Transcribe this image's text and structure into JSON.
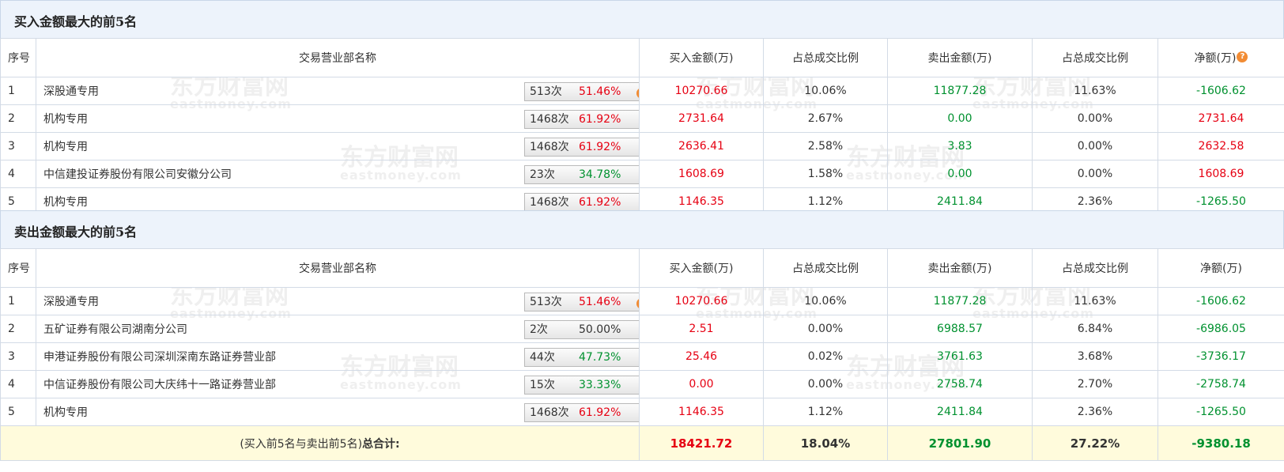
{
  "buy_section": {
    "title": "买入金额最大的前5名",
    "headers": [
      "序号",
      "交易营业部名称",
      "买入金额(万)",
      "占总成交比例",
      "卖出金额(万)",
      "占总成交比例",
      "净额(万)"
    ],
    "rows": [
      {
        "rank": "1",
        "name": "深股通专用",
        "count": "513次",
        "pct": "51.46%",
        "pct_color": "red",
        "icon": "question-icon",
        "buy": "10270.66",
        "buy_ratio": "10.06%",
        "sell": "11877.28",
        "sell_ratio": "11.63%",
        "net": "-1606.62",
        "net_color": "green"
      },
      {
        "rank": "2",
        "name": "机构专用",
        "count": "1468次",
        "pct": "61.92%",
        "pct_color": "red",
        "icon": "arrow-right-icon",
        "buy": "2731.64",
        "buy_ratio": "2.67%",
        "sell": "0.00",
        "sell_ratio": "0.00%",
        "net": "2731.64",
        "net_color": "red"
      },
      {
        "rank": "3",
        "name": "机构专用",
        "count": "1468次",
        "pct": "61.92%",
        "pct_color": "red",
        "icon": "arrow-right-icon",
        "buy": "2636.41",
        "buy_ratio": "2.58%",
        "sell": "3.83",
        "sell_ratio": "0.00%",
        "net": "2632.58",
        "net_color": "red"
      },
      {
        "rank": "4",
        "name": "中信建投证券股份有限公司安徽分公司",
        "count": "23次",
        "pct": "34.78%",
        "pct_color": "green",
        "icon": "arrow-right-icon",
        "buy": "1608.69",
        "buy_ratio": "1.58%",
        "sell": "0.00",
        "sell_ratio": "0.00%",
        "net": "1608.69",
        "net_color": "red"
      },
      {
        "rank": "5",
        "name": "机构专用",
        "count": "1468次",
        "pct": "61.92%",
        "pct_color": "red",
        "icon": "arrow-right-icon",
        "buy": "1146.35",
        "buy_ratio": "1.12%",
        "sell": "2411.84",
        "sell_ratio": "2.36%",
        "net": "-1265.50",
        "net_color": "green"
      }
    ]
  },
  "sell_section": {
    "title": "卖出金额最大的前5名",
    "headers": [
      "序号",
      "交易营业部名称",
      "买入金额(万)",
      "占总成交比例",
      "卖出金额(万)",
      "占总成交比例",
      "净额(万)"
    ],
    "rows": [
      {
        "rank": "1",
        "name": "深股通专用",
        "count": "513次",
        "pct": "51.46%",
        "pct_color": "red",
        "icon": "question-icon",
        "buy": "10270.66",
        "buy_ratio": "10.06%",
        "sell": "11877.28",
        "sell_ratio": "11.63%",
        "net": "-1606.62",
        "net_color": "green"
      },
      {
        "rank": "2",
        "name": "五矿证券有限公司湖南分公司",
        "count": "2次",
        "pct": "50.00%",
        "pct_color": "dark",
        "icon": "arrow-right-icon",
        "buy": "2.51",
        "buy_ratio": "0.00%",
        "sell": "6988.57",
        "sell_ratio": "6.84%",
        "net": "-6986.05",
        "net_color": "green"
      },
      {
        "rank": "3",
        "name": "申港证券股份有限公司深圳深南东路证券营业部",
        "count": "44次",
        "pct": "47.73%",
        "pct_color": "green",
        "icon": "arrow-right-icon",
        "buy": "25.46",
        "buy_ratio": "0.02%",
        "sell": "3761.63",
        "sell_ratio": "3.68%",
        "net": "-3736.17",
        "net_color": "green"
      },
      {
        "rank": "4",
        "name": "中信证券股份有限公司大庆纬十一路证券营业部",
        "count": "15次",
        "pct": "33.33%",
        "pct_color": "green",
        "icon": "arrow-right-icon",
        "buy": "0.00",
        "buy_ratio": "0.00%",
        "sell": "2758.74",
        "sell_ratio": "2.70%",
        "net": "-2758.74",
        "net_color": "green"
      },
      {
        "rank": "5",
        "name": "机构专用",
        "count": "1468次",
        "pct": "61.92%",
        "pct_color": "red",
        "icon": "arrow-right-icon",
        "buy": "1146.35",
        "buy_ratio": "1.12%",
        "sell": "2411.84",
        "sell_ratio": "2.36%",
        "net": "-1265.50",
        "net_color": "green"
      }
    ]
  },
  "total": {
    "label_prefix": "(买入前5名与卖出前5名)",
    "label_bold": "总合计:",
    "buy": "18421.72",
    "buy_ratio": "18.04%",
    "sell": "27801.90",
    "sell_ratio": "27.22%",
    "net": "-9380.18"
  },
  "watermark": {
    "cn": "东方财富网",
    "en": "eastmoney.com"
  },
  "colors": {
    "red": "#e60012",
    "green": "#00912f",
    "header_bg": "#edf3fb",
    "total_bg": "#fffbdc"
  }
}
